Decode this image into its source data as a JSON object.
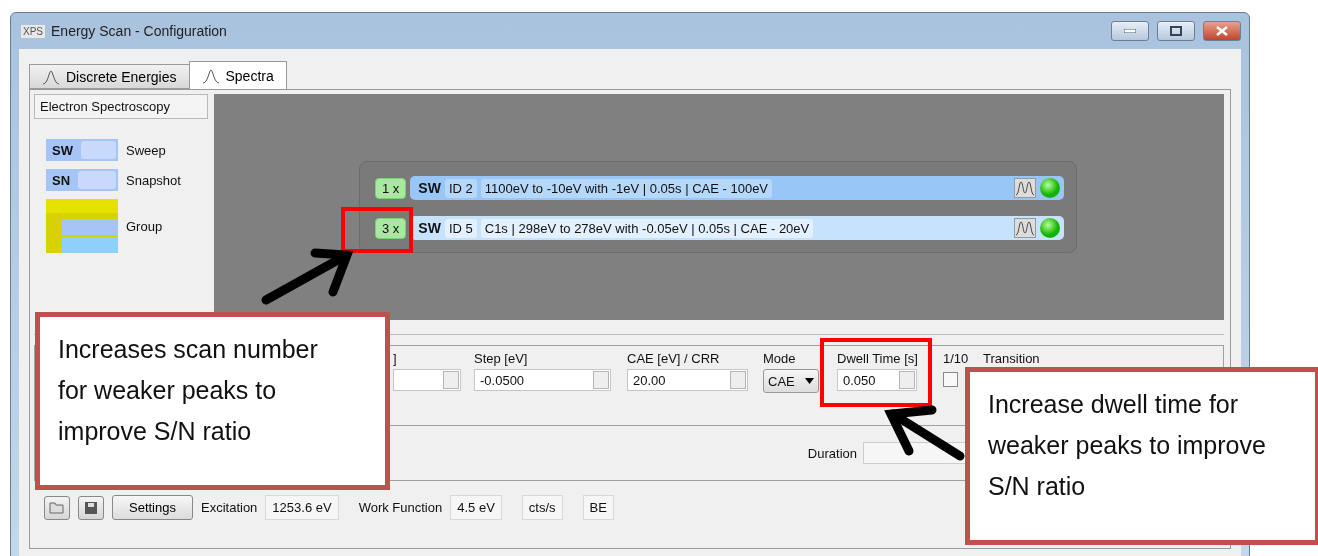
{
  "window": {
    "app_badge": "XPS",
    "title": "Energy Scan - Configuration"
  },
  "tabs": [
    {
      "label": "Discrete Energies",
      "selected": false
    },
    {
      "label": "Spectra",
      "selected": true
    }
  ],
  "sidebar": {
    "header": "Electron Spectroscopy",
    "legend": [
      {
        "kind": "sweep",
        "code": "SW",
        "label": "Sweep"
      },
      {
        "kind": "snapshot",
        "code": "SN",
        "label": "Snapshot"
      },
      {
        "kind": "group",
        "label": "Group"
      }
    ]
  },
  "scan_list": {
    "rows": [
      {
        "count": "1 x",
        "type": "SW",
        "id": "ID 2",
        "description": "1100eV to -10eV with -1eV | 0.05s | CAE - 100eV",
        "selected": true
      },
      {
        "count": "3 x",
        "type": "SW",
        "id": "ID 5",
        "description": "C1s | 298eV to 278eV with -0.05eV | 0.05s | CAE - 20eV",
        "selected": false
      }
    ]
  },
  "form": {
    "fields": [
      {
        "kind": "spin",
        "label": "]"
      },
      {
        "kind": "spin",
        "label": "Step [eV]",
        "value": "-0.0500"
      },
      {
        "kind": "spin",
        "label": "CAE [eV] / CRR",
        "value": "20.00"
      },
      {
        "kind": "combo",
        "label": "Mode",
        "value": "CAE"
      },
      {
        "kind": "spin",
        "label": "Dwell Time [s]",
        "value": "0.050"
      },
      {
        "kind": "checkbox",
        "label": "1/10",
        "checked": false
      },
      {
        "kind": "text",
        "label": "Transition"
      }
    ],
    "duration_label": "Duration"
  },
  "toolbar": {
    "settings": "Settings",
    "excitation_label": "Excitation",
    "excitation": "1253.6 eV",
    "work_function_label": "Work Function",
    "work_function": "4.5 eV",
    "unit": "cts/s",
    "scale": "BE"
  },
  "callouts": [
    {
      "text": "Increases scan number for weaker peaks to improve S/N ratio"
    },
    {
      "text": "Increase dwell time for weaker peaks to improve S/N ratio"
    }
  ]
}
